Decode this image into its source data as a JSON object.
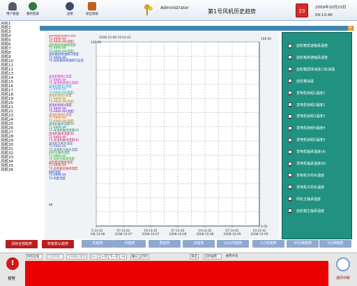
{
  "toolbar": {
    "buttons": [
      {
        "label": "用户管理",
        "icon": "user-management-icon",
        "color": "#555b66"
      },
      {
        "label": "重新登录",
        "icon": "relogin-icon",
        "color": "#2f7a3a"
      },
      {
        "label": "注销",
        "icon": "logout-icon",
        "color": "#3b4a6b"
      },
      {
        "label": "退出系统",
        "icon": "exit-icon",
        "color": "#c06020"
      }
    ]
  },
  "header": {
    "user": "Administrator",
    "title": "第1号风机历史趋势",
    "date": "2009年10月23日",
    "time": "09:13:40",
    "calendar_day": "23"
  },
  "turbines": [
    "风机1",
    "风机2",
    "风机3",
    "风机4",
    "风机5",
    "风机6",
    "风机7",
    "风机8",
    "风机9",
    "风机10",
    "风机11",
    "风机12",
    "风机13",
    "风机14",
    "风机15",
    "风机16",
    "风机17",
    "风机18",
    "风机19",
    "风机20",
    "风机21",
    "风机22",
    "风机23",
    "风机24",
    "风机25",
    "风机26",
    "风机27",
    "风机28",
    "风机29",
    "风机30",
    "风机31",
    "风机32",
    "风机33",
    "风机34",
    "风机35",
    "风机36"
  ],
  "legend": {
    "items": [
      {
        "text": "齿轮箱低速轴承温度",
        "color": "#cc1a1a"
      },
      {
        "text": "T1-9999.99",
        "color": "#cc1a1a"
      },
      {
        "text": "T2-9999.99(温度)",
        "color": "#cc1a1a"
      },
      {
        "text": "齿轮箱高速轴承温度",
        "color": "#14a020"
      },
      {
        "text": "T1-9999.99",
        "color": "#14a020"
      },
      {
        "text": "T2-9999.99(温度)",
        "color": "#14a020"
      },
      {
        "text": "齿轮箱润滑油进口温度",
        "color": "#1838c8"
      },
      {
        "text": "T1-9999.99",
        "color": "#1838c8"
      },
      {
        "text": "T2-齿轮箱润滑油进口压差",
        "color": "#1838c8"
      },
      {
        "text": "",
        "color": "#fff"
      },
      {
        "text": "",
        "color": "#fff"
      },
      {
        "text": "",
        "color": "#fff"
      },
      {
        "text": "",
        "color": "#fff"
      },
      {
        "text": "发电机绕组1温度",
        "color": "#d020c0"
      },
      {
        "text": "T1-9999.99",
        "color": "#d020c0"
      },
      {
        "text": "T2-发电机绕组2(温度)",
        "color": "#d020c0"
      },
      {
        "text": "发电机绕组2温度",
        "color": "#20a0d0"
      },
      {
        "text": "T1-9999.99",
        "color": "#20a0d0"
      },
      {
        "text": "T2-9999.99(温度)",
        "color": "#20a0d0"
      },
      {
        "text": "发电机绕组3温度",
        "color": "#a08010"
      },
      {
        "text": "T1-9999.99",
        "color": "#a08010"
      },
      {
        "text": "T2-9999.99(温度)",
        "color": "#a08010"
      },
      {
        "text": "发电机绕组4温度",
        "color": "#7010c0"
      },
      {
        "text": "T1-9999.99",
        "color": "#7010c0"
      },
      {
        "text": "T2-9999.99(温度)",
        "color": "#7010c0"
      },
      {
        "text": "发电机绕组5温度",
        "color": "#d06010"
      },
      {
        "text": "T1-9999.99",
        "color": "#d06010"
      },
      {
        "text": "T2-9999.99(温度)",
        "color": "#d06010"
      },
      {
        "text": "发电机轴承温度(A)",
        "color": "#108060"
      },
      {
        "text": "T1-9999.99",
        "color": "#108060"
      },
      {
        "text": "T2-发电机轴承温度(A)",
        "color": "#108060"
      },
      {
        "text": "发电机轴承温度(B)",
        "color": "#c01060"
      },
      {
        "text": "T1-9999.99",
        "color": "#c01060"
      },
      {
        "text": "T2-发电机轴承温度(B)",
        "color": "#c01060"
      },
      {
        "text": "发电机冷却水温度",
        "color": "#4060a0"
      },
      {
        "text": "T1-9999.99",
        "color": "#4060a0"
      },
      {
        "text": "T2-发电机冷却水温度",
        "color": "#4060a0"
      },
      {
        "text": "风轮主轴承温度",
        "color": "#20a020"
      },
      {
        "text": "T1-9999.99",
        "color": "#20a020"
      },
      {
        "text": "T2-风轮主轴承温度",
        "color": "#20a020"
      },
      {
        "text": "齿轮箱主轴承温度",
        "color": "#c02020"
      },
      {
        "text": "T1-9999.99",
        "color": "#c02020"
      },
      {
        "text": "T2-齿轮箱主轴承温度",
        "color": "#c02020"
      },
      {
        "text": "机舱温度",
        "color": "#2040c0"
      },
      {
        "text": "T1-9999.99",
        "color": "#2040c0"
      },
      {
        "text": "T2-机舱温度",
        "color": "#2040c0"
      }
    ],
    "count": "4ll"
  },
  "checkboxes": [
    {
      "label": "齿轮箱低速轴承温度",
      "checked": true
    },
    {
      "label": "齿轮箱高速轴承温度",
      "checked": true
    },
    {
      "label": "齿轮箱润滑油进口处油温",
      "checked": true
    },
    {
      "label": "齿轮箱油温",
      "checked": true
    },
    {
      "label": "发电机绕组1温度1",
      "checked": true
    },
    {
      "label": "发电机绕组2温度2",
      "checked": true
    },
    {
      "label": "发电机绕组3温度3",
      "checked": true
    },
    {
      "label": "发电机绕组4温度4",
      "checked": true
    },
    {
      "label": "发电机绕组5温度5",
      "checked": true
    },
    {
      "label": "发电机轴承温度(A)",
      "checked": true
    },
    {
      "label": "发电机轴承温度(B)",
      "checked": true
    },
    {
      "label": "发电机冷却水温度",
      "checked": true
    },
    {
      "label": "发电机冷却水温度",
      "checked": true
    },
    {
      "label": "风轮主轴承温度",
      "checked": true
    },
    {
      "label": "齿轮箱主轴承温度",
      "checked": true
    }
  ],
  "buttons": {
    "clear": "清除全部趋势",
    "restore": "恢复默认趋势",
    "ranges": [
      "年趋势",
      "月趋势",
      "周趋势",
      "日趋势",
      "12小时趋势",
      "1小时趋势",
      "30分钟趋势",
      "5分钟趋势"
    ]
  },
  "alarm": {
    "label": "报警",
    "scope": "所有区域",
    "level": "全部等级",
    "ack": "全部确认类型",
    "pages": [
      "|<-",
      "上一页",
      "下一页",
      "->|"
    ],
    "confirm": "确认",
    "print": "打印",
    "filter": "筛选",
    "realtime": "实时报警",
    "sound": "报警声音"
  },
  "comm": {
    "label": "通讯中断"
  },
  "chart_data": {
    "type": "line",
    "title_timestamp": "2008-10-08 19:14:42",
    "y_right_top": "190.00",
    "y_left_top": "100.00",
    "y_right_bottom": "0.00",
    "x_ticks": [
      {
        "time": "15:14:42",
        "date": "2008-10-06"
      },
      {
        "time": "07:14:42",
        "date": "2008-10-07"
      },
      {
        "time": "19:14:42",
        "date": "2008-10-07"
      },
      {
        "time": "07:14:42",
        "date": "2008-10-08"
      },
      {
        "time": "19:14:42",
        "date": "2008-10-08"
      },
      {
        "time": "07:14:42",
        "date": "2008-10-09"
      },
      {
        "time": "19:14:42",
        "date": "2008-10-09"
      }
    ],
    "series": [],
    "grid": true,
    "plot_bg": "#ffffff",
    "grid_color": "#9a9a9a"
  }
}
